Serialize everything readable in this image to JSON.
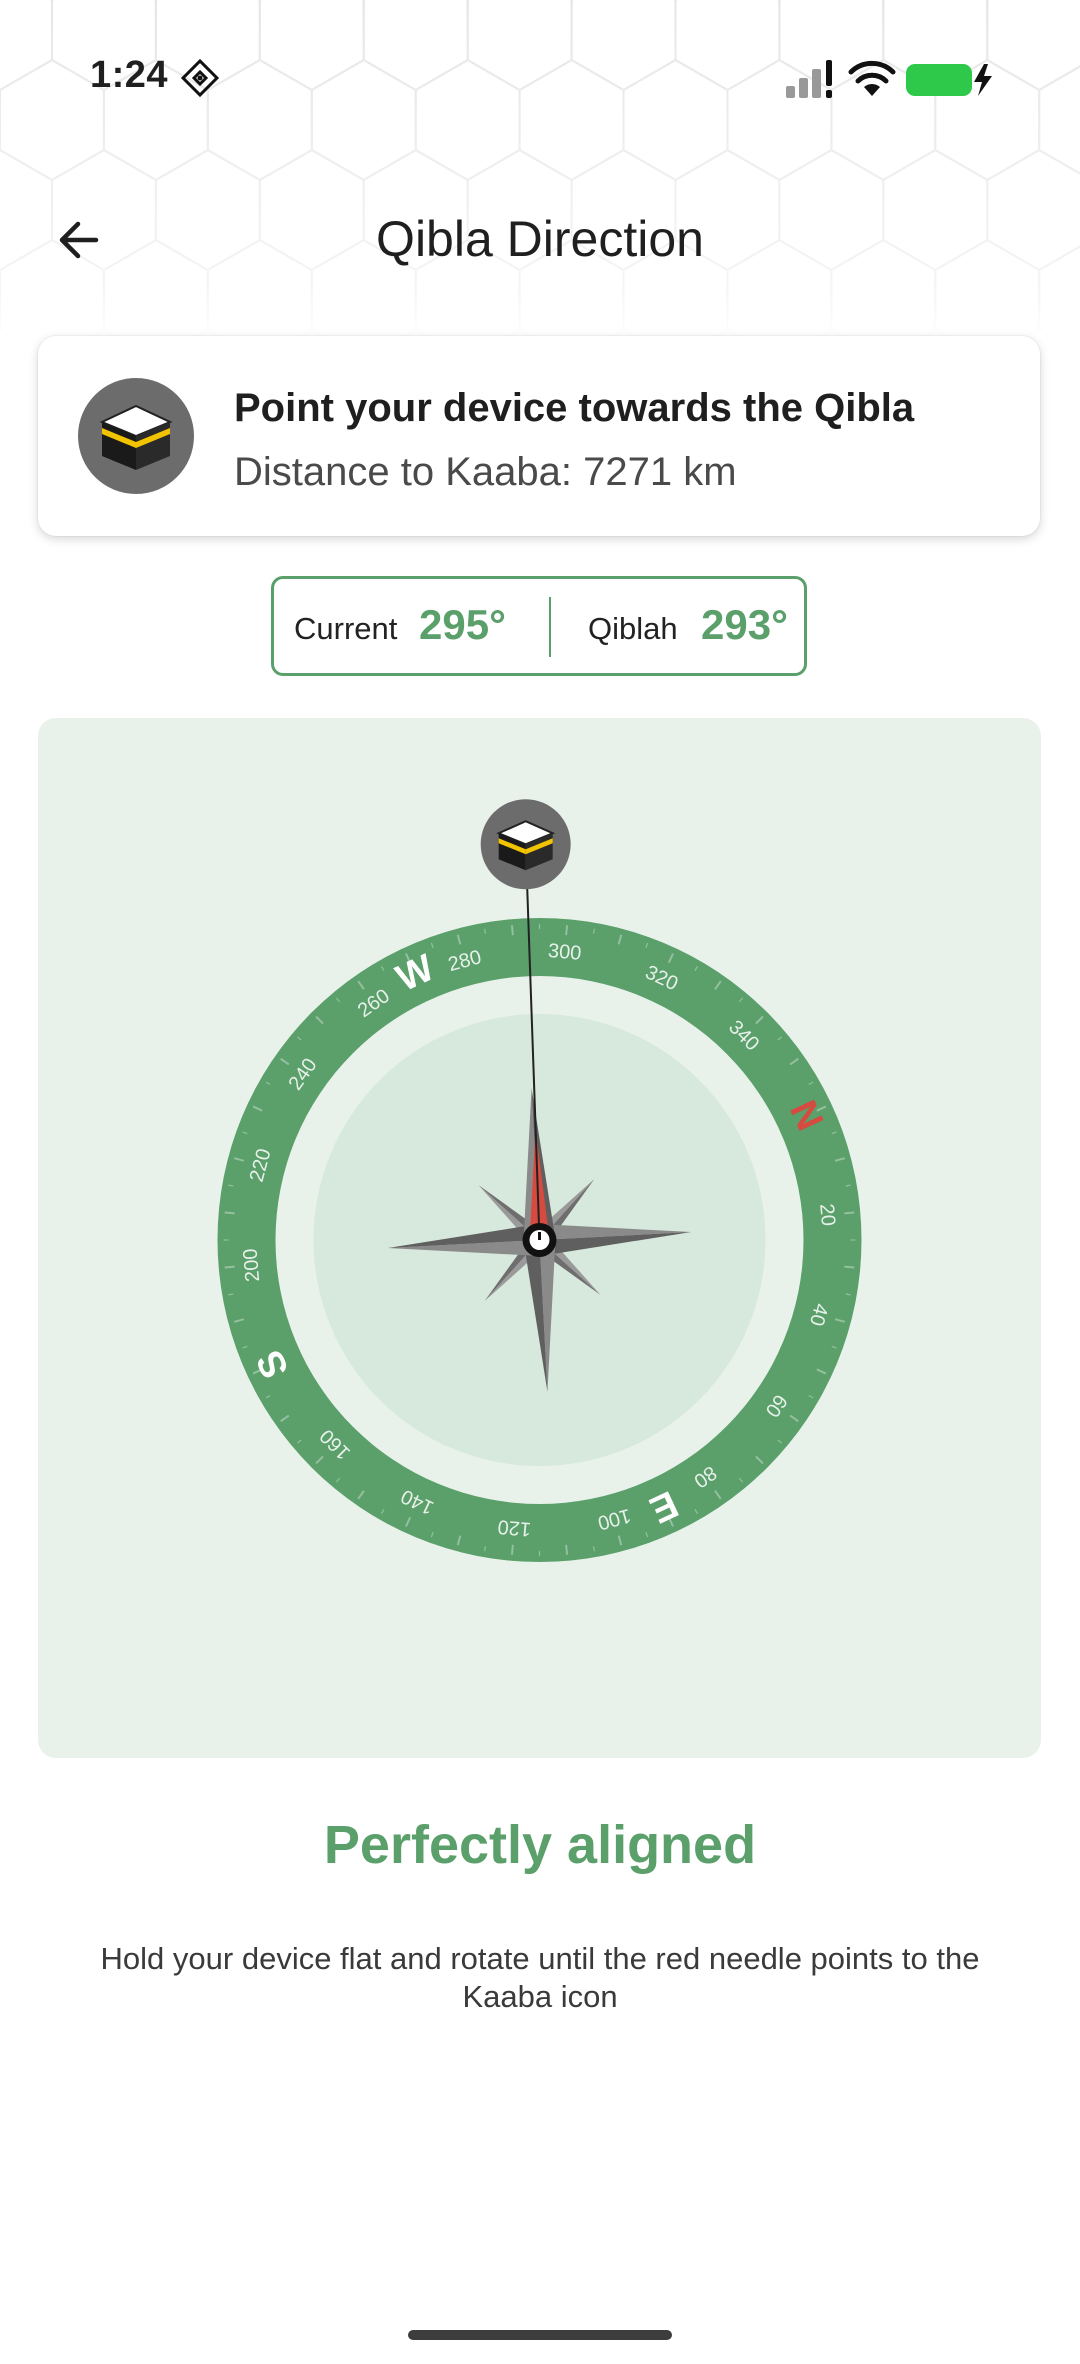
{
  "status_bar": {
    "time": "1:24",
    "battery_level_percent": 100,
    "battery_color": "#2ec94b",
    "icons": [
      "nfc-icon",
      "signal-icon",
      "wifi-icon",
      "battery-charging-icon"
    ]
  },
  "header": {
    "title": "Qibla Direction",
    "back_icon": "arrow-left-icon"
  },
  "info_card": {
    "icon": "kaaba-icon",
    "title": "Point your device towards the Qibla",
    "subtitle": "Distance to Kaaba: 7271 km"
  },
  "readings": {
    "current_label": "Current",
    "current_value": "295°",
    "qiblah_label": "Qiblah",
    "qiblah_value": "293°"
  },
  "compass": {
    "current_heading_deg": 295,
    "qibla_bearing_deg": 293,
    "cardinals": [
      {
        "label": "N",
        "deg": 0,
        "color": "#d64a3f"
      },
      {
        "label": "E",
        "deg": 90,
        "color": "#ffffff"
      },
      {
        "label": "S",
        "deg": 180,
        "color": "#ffffff"
      },
      {
        "label": "W",
        "deg": 270,
        "color": "#ffffff"
      }
    ],
    "degree_labels": [
      "20",
      "40",
      "60",
      "80",
      "100",
      "120",
      "140",
      "160",
      "200",
      "220",
      "240",
      "260",
      "280",
      "300",
      "320",
      "340"
    ],
    "colors": {
      "ring": "#5b9f6b",
      "inner_disc": "#d7e8dc",
      "panel": "#e8f2ea",
      "needle_red": "#d64a3f"
    }
  },
  "alignment_status": "Perfectly aligned",
  "hint": "Hold your device flat and rotate until the red needle points to the Kaaba icon",
  "colors": {
    "accent": "#5b9f6b"
  }
}
